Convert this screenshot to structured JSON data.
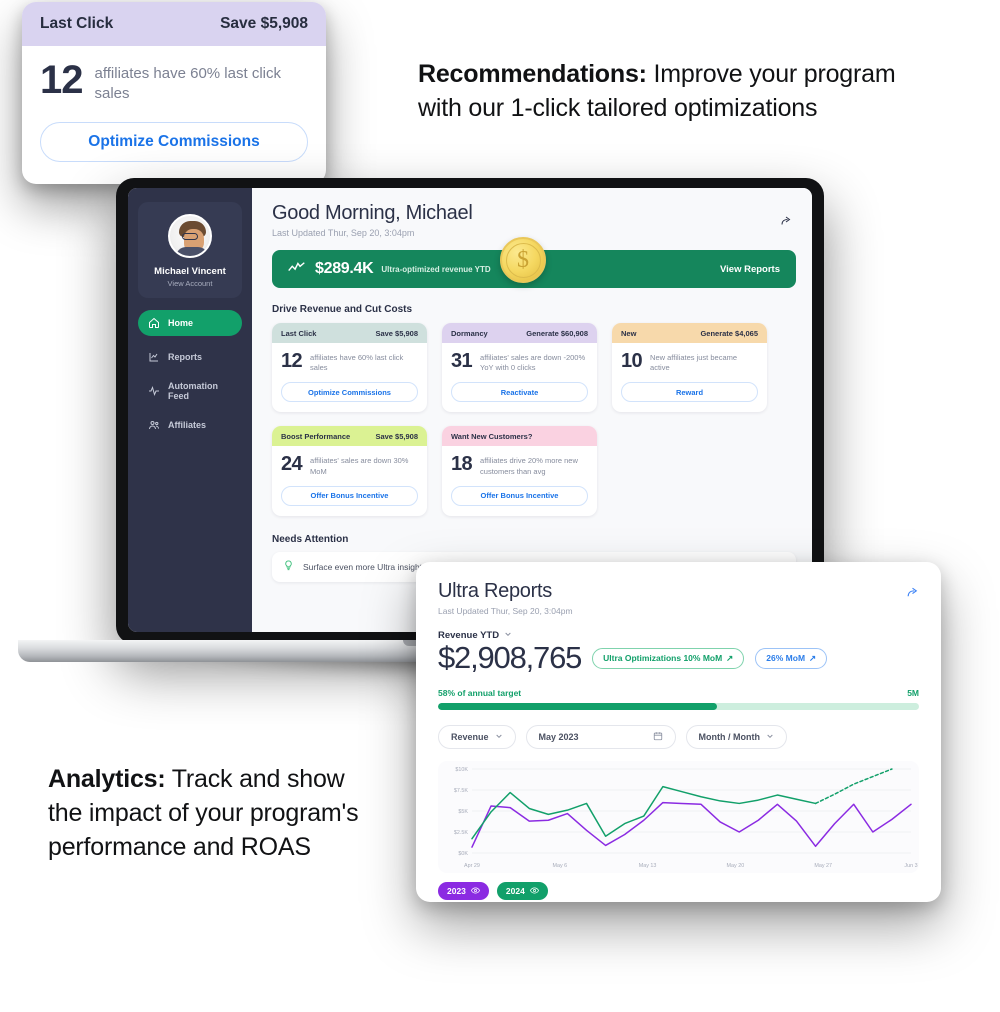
{
  "captions": {
    "recommendations_bold": "Recommendations:",
    "recommendations_rest": " Improve your program with our 1-click tailored optimizations",
    "analytics_bold": "Analytics:",
    "analytics_rest": " Track and show the impact of your program's performance and ROAS"
  },
  "float_card": {
    "header_title": "Last Click",
    "header_value": "Save $5,908",
    "number": "12",
    "text": "affiliates have 60% last click sales",
    "button": "Optimize Commissions",
    "header_bg": "#d9d3f0",
    "button_color": "#1a73e8"
  },
  "sidebar": {
    "profile": {
      "name": "Michael Vincent",
      "link": "View Account"
    },
    "items": [
      {
        "label": "Home",
        "icon": "home-icon",
        "active": true
      },
      {
        "label": "Reports",
        "icon": "chart-icon",
        "active": false
      },
      {
        "label": "Automation Feed",
        "icon": "pulse-icon",
        "active": false
      },
      {
        "label": "Affiliates",
        "icon": "people-icon",
        "active": false
      }
    ],
    "bg": "#2f3349",
    "active_bg": "#12a06a"
  },
  "dashboard": {
    "greeting": "Good Morning, Michael",
    "last_updated": "Last Updated Thur, Sep 20, 3:04pm",
    "share_icon": "share-icon",
    "revenue_banner": {
      "amount": "$289.4K",
      "label": "Ultra-optimized revenue YTD",
      "cta": "View Reports",
      "bg": "#15865c",
      "coin_icon": "dollar-coin-icon"
    },
    "section_title": "Drive Revenue and Cut Costs",
    "cards": [
      {
        "title": "Last Click",
        "value": "Save $5,908",
        "number": "12",
        "text": "affiliates have 60% last click sales",
        "button": "Optimize Commissions",
        "header_bg": "#cfe0dd"
      },
      {
        "title": "Dormancy",
        "value": "Generate $60,908",
        "number": "31",
        "text": "affiliates' sales are down -200% YoY with 0 clicks",
        "button": "Reactivate",
        "header_bg": "#ddd2ef"
      },
      {
        "title": "New",
        "value": "Generate $4,065",
        "number": "10",
        "text": "New affiliates just became active",
        "button": "Reward",
        "header_bg": "#f7d9ab"
      },
      {
        "title": "Boost Performance",
        "value": "Save $5,908",
        "number": "24",
        "text": "affiliates' sales are down 30% MoM",
        "button": "Offer Bonus Incentive",
        "header_bg": "#dbf293"
      },
      {
        "title": "Want New Customers?",
        "value": "",
        "number": "18",
        "text": "affiliates drive 20% more new customers than avg",
        "button": "Offer Bonus Incentive",
        "header_bg": "#fad2e1"
      }
    ],
    "needs_attention": {
      "title": "Needs Attention",
      "item_icon": "lightbulb-icon",
      "item_text": "Surface even more Ultra insights"
    }
  },
  "reports": {
    "title": "Ultra Reports",
    "last_updated": "Last Updated Thur, Sep 20, 3:04pm",
    "share_icon": "share-icon",
    "metric_selector": "Revenue YTD",
    "metric_chevron": "chevron-down-icon",
    "amount": "$2,908,765",
    "badges": [
      {
        "label": "Ultra Optimizations 10% MoM",
        "arrow": "↗",
        "style": "green"
      },
      {
        "label": "26% MoM",
        "arrow": "↗",
        "style": "blue"
      }
    ],
    "target_text": "58% of annual target",
    "target_max": "5M",
    "target_percent": 58,
    "filters": [
      {
        "label": "Revenue",
        "icon": "chevron-down-icon"
      },
      {
        "label": "May 2023",
        "icon": "calendar-icon"
      },
      {
        "label": "Month / Month",
        "icon": "chevron-down-icon"
      }
    ],
    "legend": [
      {
        "label": "2023",
        "color": "#8b2be2",
        "icon": "eye-icon"
      },
      {
        "label": "2024",
        "color": "#12a06a",
        "icon": "eye-icon"
      }
    ]
  },
  "chart_data": {
    "type": "line",
    "title": "",
    "xlabel": "",
    "ylabel": "",
    "ylim": [
      0,
      10000
    ],
    "ytick_labels": [
      "$0K",
      "$2.5K",
      "$5K",
      "$7.5K",
      "$10K"
    ],
    "ytick_values": [
      0,
      2500,
      5000,
      7500,
      10000
    ],
    "xtick_labels": [
      "Apr 29",
      "May 6",
      "May 13",
      "May 20",
      "May 27",
      "Jun 3"
    ],
    "grid": true,
    "legend_position": "bottom-left",
    "x": [
      0,
      1,
      2,
      3,
      4,
      5,
      6,
      7,
      8,
      9,
      10,
      11,
      12,
      13,
      14,
      15,
      16,
      17,
      18,
      19,
      20,
      21
    ],
    "series": [
      {
        "name": "2023",
        "color": "#8b2be2",
        "style": "solid",
        "values": [
          700,
          5600,
          5400,
          3800,
          3900,
          4700,
          2700,
          900,
          2200,
          3900,
          6000,
          5900,
          5800,
          3700,
          2500,
          3900,
          5800,
          3800,
          800,
          3500,
          5800,
          2500,
          4000,
          5800
        ]
      },
      {
        "name": "2024",
        "color": "#12a06a",
        "style": "solid",
        "values": [
          1700,
          4900,
          7200,
          5300,
          4600,
          5100,
          5900,
          2000,
          3500,
          4400,
          7900,
          7300,
          6700,
          6200,
          5900,
          6300,
          6900,
          6400,
          5900
        ],
        "forecast_from_index": 18,
        "forecast_values": [
          5900,
          7000,
          8200,
          9100,
          10000
        ],
        "forecast_style": "dashed"
      }
    ]
  }
}
